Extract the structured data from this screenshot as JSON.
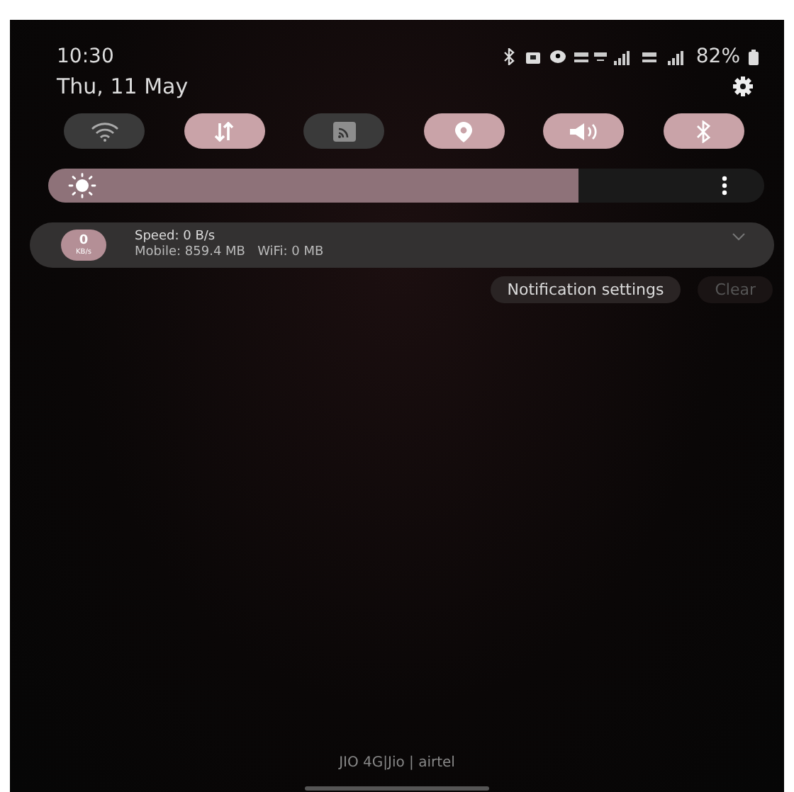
{
  "status_bar": {
    "time": "10:30",
    "battery": "82%"
  },
  "date": "Thu, 11 May",
  "quick_tiles": [
    {
      "kind": "wifi",
      "on": false
    },
    {
      "kind": "data",
      "on": true
    },
    {
      "kind": "cast",
      "on": false
    },
    {
      "kind": "location",
      "on": true
    },
    {
      "kind": "sound",
      "on": true
    },
    {
      "kind": "bluetooth",
      "on": true
    }
  ],
  "brightness": {
    "level": 0.74
  },
  "notification": {
    "badge_value": "0",
    "badge_unit": "KB/s",
    "title": "Speed: 0 B/s",
    "detail": "Mobile: 859.4 MB   WiFi: 0 MB"
  },
  "actions": [
    {
      "label": "Notification settings",
      "disabled": false
    },
    {
      "label": "Clear",
      "disabled": true
    }
  ],
  "carrier": "JIO 4G|Jio | airtel"
}
